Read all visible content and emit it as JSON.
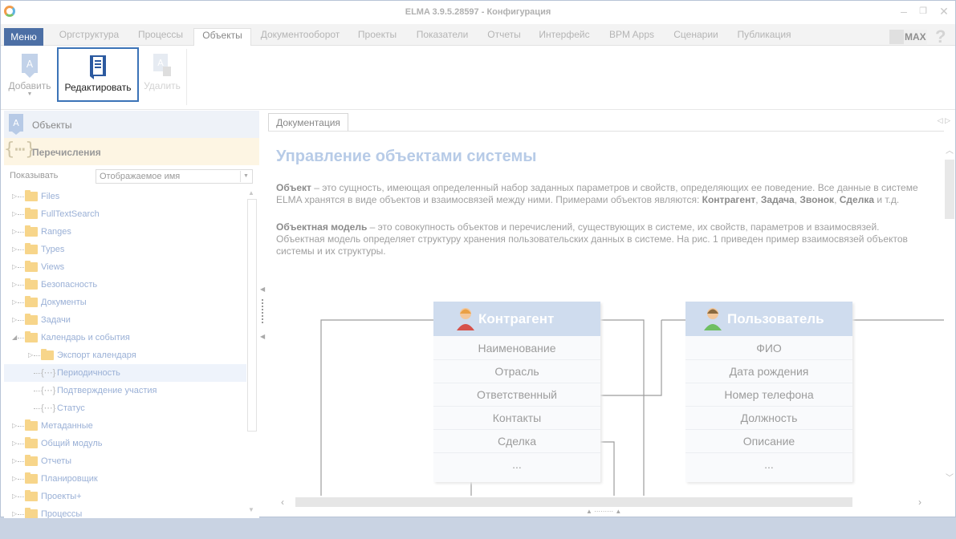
{
  "window": {
    "title": "ELMA 3.9.5.28597 - Конфигурация"
  },
  "menubar": {
    "menu_label": "Меню",
    "tabs": [
      "Оргструктура",
      "Процессы",
      "Объекты",
      "Документооборот",
      "Проекты",
      "Показатели",
      "Отчеты",
      "Интерфейс",
      "BPM Apps",
      "Сценарии",
      "Публикация"
    ],
    "active_tab": "Объекты",
    "max_label": "MAX",
    "help": "?"
  },
  "ribbon": {
    "add_label": "Добавить",
    "edit_label": "Редактировать",
    "delete_label": "Удалить"
  },
  "left_panel": {
    "objects_label": "Объекты",
    "enums_label": "Перечисления",
    "show_label": "Показывать",
    "show_value": "Отображаемое имя",
    "tree": [
      {
        "label": "Files",
        "type": "folder",
        "level": 0
      },
      {
        "label": "FullTextSearch",
        "type": "folder",
        "level": 0
      },
      {
        "label": "Ranges",
        "type": "folder",
        "level": 0
      },
      {
        "label": "Types",
        "type": "folder",
        "level": 0
      },
      {
        "label": "Views",
        "type": "folder",
        "level": 0
      },
      {
        "label": "Безопасность",
        "type": "folder",
        "level": 0
      },
      {
        "label": "Документы",
        "type": "folder",
        "level": 0
      },
      {
        "label": "Задачи",
        "type": "folder",
        "level": 0
      },
      {
        "label": "Календарь и события",
        "type": "folder",
        "level": 0,
        "expanded": true
      },
      {
        "label": "Экспорт календаря",
        "type": "folder",
        "level": 1
      },
      {
        "label": "Периодичность",
        "type": "enum",
        "level": 1,
        "selected": true
      },
      {
        "label": "Подтверждение участия",
        "type": "enum",
        "level": 1
      },
      {
        "label": "Статус",
        "type": "enum",
        "level": 1
      },
      {
        "label": "Метаданные",
        "type": "folder",
        "level": 0
      },
      {
        "label": "Общий модуль",
        "type": "folder",
        "level": 0
      },
      {
        "label": "Отчеты",
        "type": "folder",
        "level": 0
      },
      {
        "label": "Планировщик",
        "type": "folder",
        "level": 0
      },
      {
        "label": "Проекты+",
        "type": "folder",
        "level": 0
      },
      {
        "label": "Процессы",
        "type": "folder",
        "level": 0
      }
    ]
  },
  "doc": {
    "tab_label": "Документация",
    "title": "Управление объектами системы",
    "p1_term": "Объект",
    "p1_text": " – это сущность, имеющая определенный набор заданных параметров и свойств, определяющих ее поведение. Все данные в системе ELMA хранятся в виде объектов и взаимосвязей между ними. Примерами объектов являются: ",
    "p1_examples": [
      "Контрагент",
      "Задача",
      "Звонок",
      "Сделка"
    ],
    "p1_tail": " и т.д.",
    "p2_term": "Объектная модель",
    "p2_text": " – это совокупность объектов и перечислений, существующих в системе, их свойств, параметров и взаимосвязей. Объектная модель определяет структуру хранения пользовательских данных в системе. На рис. 1 приведен пример взаимосвязей объектов системы и их структуры.",
    "cards": [
      {
        "title": "Контрагент",
        "rows": [
          "Наименование",
          "Отрасль",
          "Ответственный",
          "Контакты",
          "Сделка",
          "..."
        ]
      },
      {
        "title": "Пользователь",
        "rows": [
          "ФИО",
          "Дата рождения",
          "Номер телефона",
          "Должность",
          "Описание",
          "..."
        ]
      }
    ]
  },
  "colors": {
    "accent": "#4c6fa5",
    "folder": "#f7d58a",
    "card_header": "#cfdcee"
  }
}
